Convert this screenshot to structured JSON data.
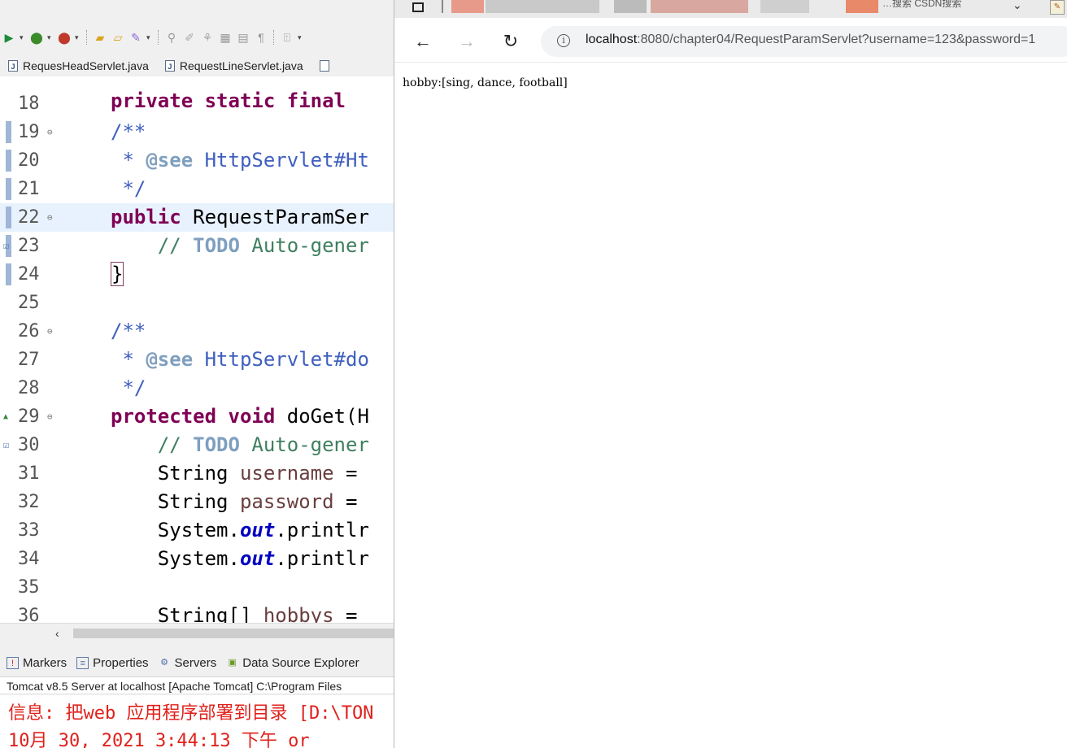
{
  "ide": {
    "tabs": [
      {
        "label": "RequesHeadServlet.java"
      },
      {
        "label": "RequestLineServlet.java"
      }
    ],
    "code_lines": [
      {
        "num": "18",
        "parts": []
      },
      {
        "num": "19",
        "parts": [
          {
            "t": "/**",
            "c": "cm"
          }
        ]
      },
      {
        "num": "20",
        "parts": [
          {
            "t": " * ",
            "c": "cm"
          },
          {
            "t": "@see",
            "c": "tag"
          },
          {
            "t": " HttpServlet#Ht",
            "c": "cm"
          }
        ]
      },
      {
        "num": "21",
        "parts": [
          {
            "t": " */",
            "c": "cm"
          }
        ]
      },
      {
        "num": "22",
        "parts": [
          {
            "t": "public",
            "c": "kw"
          },
          {
            "t": " RequestParamSer",
            "c": ""
          }
        ]
      },
      {
        "num": "23",
        "parts": [
          {
            "t": "    // ",
            "c": "lc"
          },
          {
            "t": "TODO",
            "c": "todo"
          },
          {
            "t": " Auto-gener",
            "c": "lc"
          }
        ]
      },
      {
        "num": "24",
        "parts": [
          {
            "t": "}",
            "c": "brace"
          }
        ]
      },
      {
        "num": "25",
        "parts": []
      },
      {
        "num": "26",
        "parts": [
          {
            "t": "/**",
            "c": "cm"
          }
        ]
      },
      {
        "num": "27",
        "parts": [
          {
            "t": " * ",
            "c": "cm"
          },
          {
            "t": "@see",
            "c": "tag"
          },
          {
            "t": " HttpServlet#do",
            "c": "cm"
          }
        ]
      },
      {
        "num": "28",
        "parts": [
          {
            "t": " */",
            "c": "cm"
          }
        ]
      },
      {
        "num": "29",
        "parts": [
          {
            "t": "protected",
            "c": "kw"
          },
          {
            "t": " ",
            "c": ""
          },
          {
            "t": "void",
            "c": "kw"
          },
          {
            "t": " doGet(H",
            "c": ""
          }
        ]
      },
      {
        "num": "30",
        "parts": [
          {
            "t": "    // ",
            "c": "lc"
          },
          {
            "t": "TODO",
            "c": "todo"
          },
          {
            "t": " Auto-gener",
            "c": "lc"
          }
        ]
      },
      {
        "num": "31",
        "parts": [
          {
            "t": "    String ",
            "c": ""
          },
          {
            "t": "username",
            "c": "var"
          },
          {
            "t": " =",
            "c": ""
          }
        ]
      },
      {
        "num": "32",
        "parts": [
          {
            "t": "    String ",
            "c": ""
          },
          {
            "t": "password",
            "c": "var"
          },
          {
            "t": " =",
            "c": ""
          }
        ]
      },
      {
        "num": "33",
        "parts": [
          {
            "t": "    System.",
            "c": ""
          },
          {
            "t": "out",
            "c": "field"
          },
          {
            "t": ".printlr",
            "c": ""
          }
        ]
      },
      {
        "num": "34",
        "parts": [
          {
            "t": "    System.",
            "c": ""
          },
          {
            "t": "out",
            "c": "field"
          },
          {
            "t": ".printlr",
            "c": ""
          }
        ]
      },
      {
        "num": "35",
        "parts": []
      },
      {
        "num": "36",
        "parts": [
          {
            "t": "    String[] ",
            "c": ""
          },
          {
            "t": "hobbys",
            "c": "var"
          },
          {
            "t": " =",
            "c": ""
          }
        ]
      }
    ],
    "bottom_tabs": [
      {
        "label": "Markers",
        "icon": "markers-icon"
      },
      {
        "label": "Properties",
        "icon": "properties-icon"
      },
      {
        "label": "Servers",
        "icon": "servers-icon"
      },
      {
        "label": "Data Source Explorer",
        "icon": "data-source-icon"
      }
    ],
    "console_title": "Tomcat v8.5 Server at localhost [Apache Tomcat] C:\\Program Files",
    "console_lines": [
      "信息: 把web 应用程序部署到目录 [D:\\TON",
      "10月 30, 2021 3:44:13 下午 or"
    ]
  },
  "browser": {
    "tab_text": "…搜索 CSDN搜索",
    "url_host": "localhost",
    "url_path": ":8080/chapter04/RequestParamServlet?username=123&password=1",
    "page_text": "hobby:[sing, dance, football]"
  }
}
